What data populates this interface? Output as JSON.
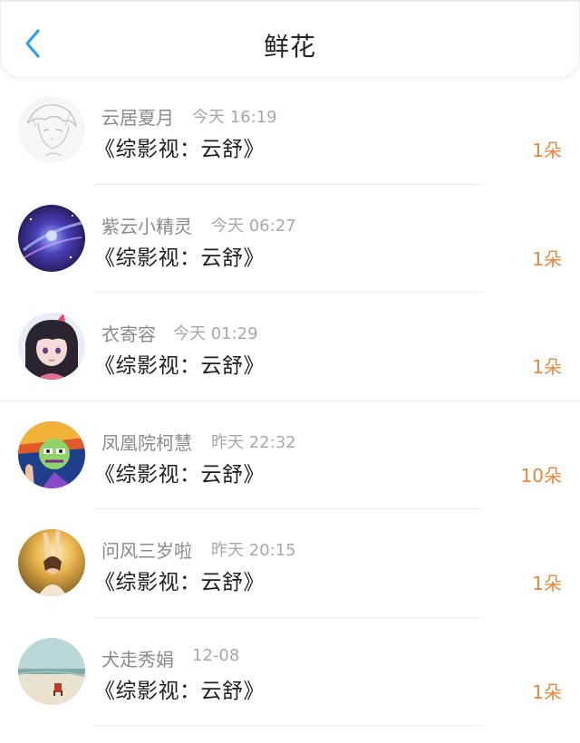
{
  "header": {
    "title": "鲜花",
    "back_icon": "chevron-left-icon",
    "accent_color": "#2f9cf0"
  },
  "count_color": "#e9863d",
  "items": [
    {
      "name": "云居夏月",
      "time": "今天 16:19",
      "book": "《综影视：云舒》",
      "count": "1朵"
    },
    {
      "name": "紫云小精灵",
      "time": "今天 06:27",
      "book": "《综影视：云舒》",
      "count": "1朵"
    },
    {
      "name": "衣寄容",
      "time": "今天 01:29",
      "book": "《综影视：云舒》",
      "count": "1朵"
    },
    {
      "name": "凤凰院柯慧",
      "time": "昨天 22:32",
      "book": "《综影视：云舒》",
      "count": "10朵"
    },
    {
      "name": "问风三岁啦",
      "time": "昨天 20:15",
      "book": "《综影视：云舒》",
      "count": "1朵"
    },
    {
      "name": "犬走秀娟",
      "time": "12-08",
      "book": "《综影视：云舒》",
      "count": "1朵"
    }
  ]
}
